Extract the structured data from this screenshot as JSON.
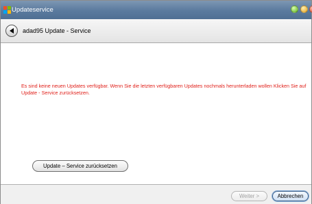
{
  "window": {
    "title": "Updateservice"
  },
  "nav": {
    "title": "adad95 Update - Service"
  },
  "content": {
    "message": "Es sind keine neuen Updates verfügbar. Wenn Sie die letzten verfügbaren Updates nochmals herunterladen wollen Klicken Sie auf Update - Service zurücksetzen.",
    "message_color": "#e0201a",
    "reset_button": "Update – Service zurücksetzen"
  },
  "footer": {
    "next_button": "Weiter >",
    "cancel_button": "Abbrechen"
  }
}
